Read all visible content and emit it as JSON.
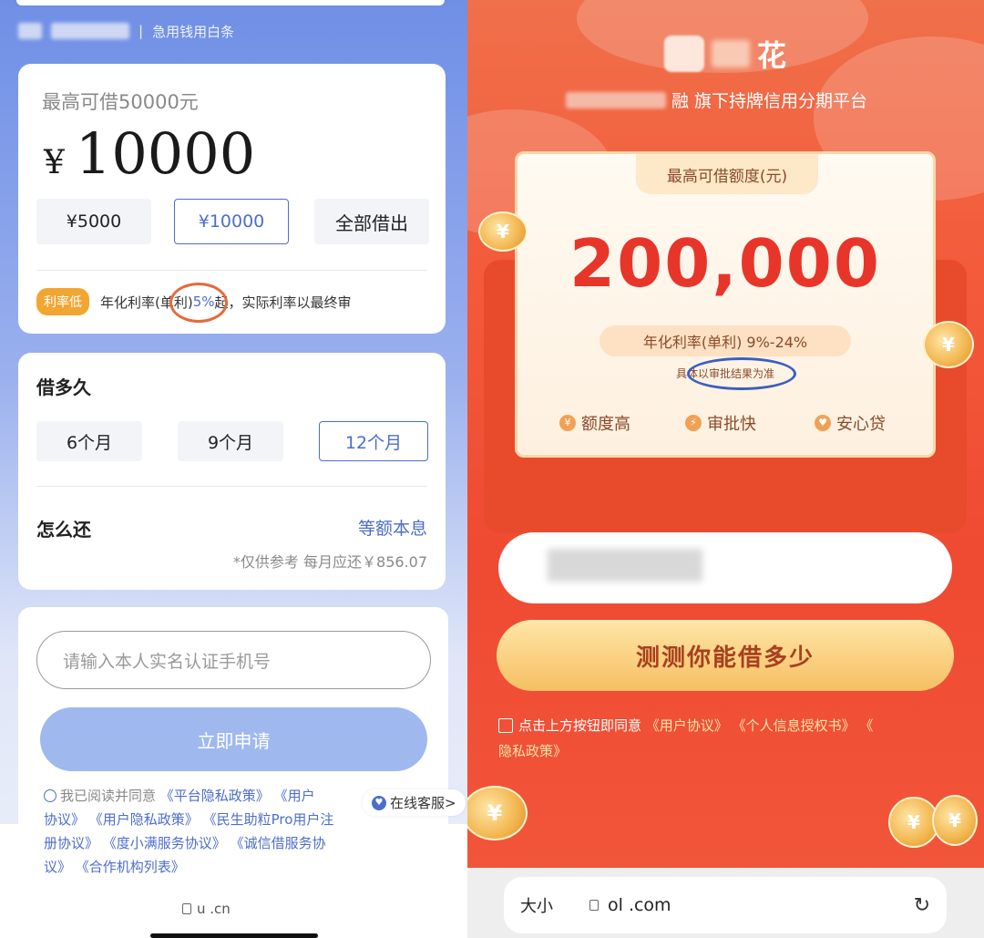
{
  "left": {
    "brand_tag": "急用钱用白条",
    "separator": "|",
    "max_label": "最高可借50000元",
    "currency": "¥",
    "amount": "10000",
    "amount_options": [
      "¥5000",
      "¥10000",
      "全部借出"
    ],
    "rate_badge": "利率低",
    "rate_prefix": "年化利率(单利)",
    "rate_value": "5%",
    "rate_suffix": "起，实际利率以最终审",
    "term_title": "借多久",
    "terms": [
      "6个月",
      "9个月",
      "12个月"
    ],
    "repay_title": "怎么还",
    "repay_method": "等额本息",
    "reference": "*仅供参考 每月应还￥856.07",
    "phone_placeholder": "请输入本人实名认证手机号",
    "apply_label": "立即申请",
    "agree_prefix": "我已阅读并同意",
    "agreements": [
      "《平台隐私政策》",
      "《用户",
      "协议》",
      "《用户隐私政策》",
      "《民生助粒Pro用户注",
      "册协议》",
      "《度小满服务协议》",
      "《诚信借服务协",
      "议》",
      "《合作机构列表》"
    ],
    "online_service": "在线客服>",
    "url": "u          .cn"
  },
  "right": {
    "logo_char": "花",
    "subtitle": "融 旗下持牌信用分期平台",
    "card_tab": "最高可借额度(元)",
    "amount": "200,000",
    "rate": "年化利率(单利) 9%-24%",
    "rate_note": "具体以审批结果为准",
    "features": [
      "额度高",
      "审批快",
      "安心贷"
    ],
    "test_button": "测测你能借多少",
    "agree_prefix": "点击上方按钮即同意",
    "agreements": [
      "《用户协议》",
      "《个人信息授权书》",
      "《",
      "隐私政策》"
    ],
    "browser_size": "大小",
    "url": "ol            .com"
  },
  "colors": {
    "left_accent": "#4d6ec9",
    "right_red": "#e8352a",
    "rate_badge": "#f2a632"
  },
  "icons": [
    "lock-icon",
    "reload-icon",
    "heart-icon",
    "yen-icon",
    "lightning-icon",
    "shield-icon",
    "checkbox-icon",
    "radio-icon"
  ]
}
